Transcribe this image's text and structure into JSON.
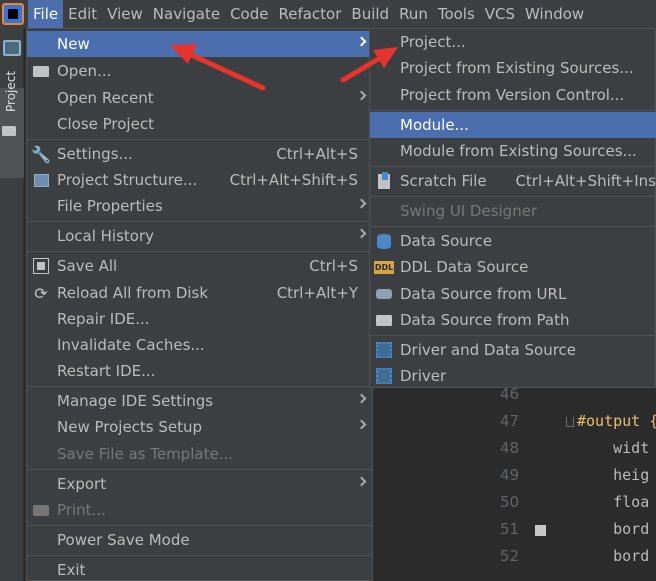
{
  "menubar": [
    "File",
    "Edit",
    "View",
    "Navigate",
    "Code",
    "Refactor",
    "Build",
    "Run",
    "Tools",
    "VCS",
    "Window"
  ],
  "sidebar": {
    "project_tab": "Project"
  },
  "file_menu": {
    "new": "New",
    "open": "Open...",
    "open_recent": "Open Recent",
    "close_project": "Close Project",
    "settings": "Settings...",
    "settings_shortcut": "Ctrl+Alt+S",
    "project_structure": "Project Structure...",
    "project_structure_shortcut": "Ctrl+Alt+Shift+S",
    "file_properties": "File Properties",
    "local_history": "Local History",
    "save_all": "Save All",
    "save_all_shortcut": "Ctrl+S",
    "reload_all": "Reload All from Disk",
    "reload_all_shortcut": "Ctrl+Alt+Y",
    "repair_ide": "Repair IDE...",
    "invalidate_caches": "Invalidate Caches...",
    "restart_ide": "Restart IDE...",
    "manage_ide_settings": "Manage IDE Settings",
    "new_projects_setup": "New Projects Setup",
    "save_file_as_template": "Save File as Template...",
    "export": "Export",
    "print": "Print...",
    "power_save_mode": "Power Save Mode",
    "exit": "Exit"
  },
  "new_menu": {
    "project": "Project...",
    "project_existing": "Project from Existing Sources...",
    "project_vcs": "Project from Version Control...",
    "module": "Module...",
    "module_existing": "Module from Existing Sources...",
    "scratch_file": "Scratch File",
    "scratch_file_shortcut": "Ctrl+Alt+Shift+Ins",
    "swing_ui_designer": "Swing UI Designer",
    "data_source": "Data Source",
    "ddl_data_source": "DDL Data Source",
    "data_source_url": "Data Source from URL",
    "data_source_path": "Data Source from Path",
    "driver_and_data_source": "Driver and Data Source",
    "driver": "Driver"
  },
  "editor": {
    "line_numbers": [
      "46",
      "47",
      "48",
      "49",
      "50",
      "51",
      "52"
    ],
    "lines": [
      "",
      "#output {",
      "    widt",
      "    heig",
      "    floa",
      "    bord",
      "    bord"
    ]
  },
  "colors": {
    "selection": "#4b6eaf",
    "menu_bg": "#3c3f41",
    "annotation_arrow": "#e8322c"
  }
}
